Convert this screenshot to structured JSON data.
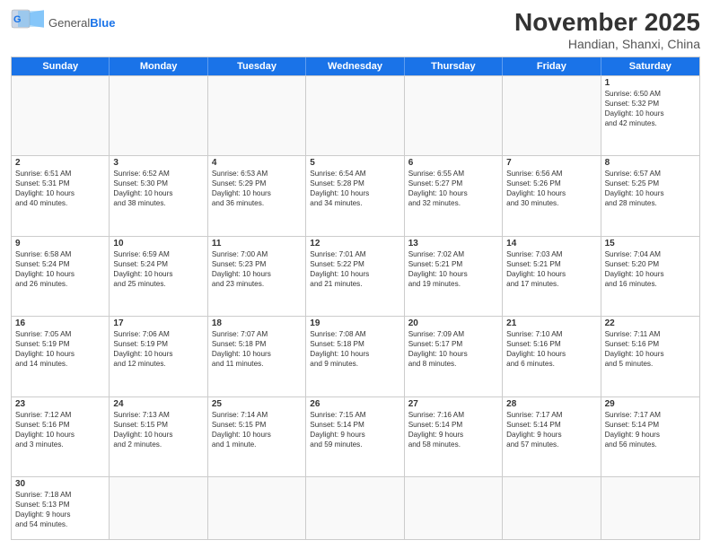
{
  "header": {
    "logo_line1": "General",
    "logo_line2": "Blue",
    "month_title": "November 2025",
    "subtitle": "Handian, Shanxi, China"
  },
  "day_headers": [
    "Sunday",
    "Monday",
    "Tuesday",
    "Wednesday",
    "Thursday",
    "Friday",
    "Saturday"
  ],
  "weeks": [
    [
      {
        "day": "",
        "info": ""
      },
      {
        "day": "",
        "info": ""
      },
      {
        "day": "",
        "info": ""
      },
      {
        "day": "",
        "info": ""
      },
      {
        "day": "",
        "info": ""
      },
      {
        "day": "",
        "info": ""
      },
      {
        "day": "1",
        "info": "Sunrise: 6:50 AM\nSunset: 5:32 PM\nDaylight: 10 hours\nand 42 minutes."
      }
    ],
    [
      {
        "day": "2",
        "info": "Sunrise: 6:51 AM\nSunset: 5:31 PM\nDaylight: 10 hours\nand 40 minutes."
      },
      {
        "day": "3",
        "info": "Sunrise: 6:52 AM\nSunset: 5:30 PM\nDaylight: 10 hours\nand 38 minutes."
      },
      {
        "day": "4",
        "info": "Sunrise: 6:53 AM\nSunset: 5:29 PM\nDaylight: 10 hours\nand 36 minutes."
      },
      {
        "day": "5",
        "info": "Sunrise: 6:54 AM\nSunset: 5:28 PM\nDaylight: 10 hours\nand 34 minutes."
      },
      {
        "day": "6",
        "info": "Sunrise: 6:55 AM\nSunset: 5:27 PM\nDaylight: 10 hours\nand 32 minutes."
      },
      {
        "day": "7",
        "info": "Sunrise: 6:56 AM\nSunset: 5:26 PM\nDaylight: 10 hours\nand 30 minutes."
      },
      {
        "day": "8",
        "info": "Sunrise: 6:57 AM\nSunset: 5:25 PM\nDaylight: 10 hours\nand 28 minutes."
      }
    ],
    [
      {
        "day": "9",
        "info": "Sunrise: 6:58 AM\nSunset: 5:24 PM\nDaylight: 10 hours\nand 26 minutes."
      },
      {
        "day": "10",
        "info": "Sunrise: 6:59 AM\nSunset: 5:24 PM\nDaylight: 10 hours\nand 25 minutes."
      },
      {
        "day": "11",
        "info": "Sunrise: 7:00 AM\nSunset: 5:23 PM\nDaylight: 10 hours\nand 23 minutes."
      },
      {
        "day": "12",
        "info": "Sunrise: 7:01 AM\nSunset: 5:22 PM\nDaylight: 10 hours\nand 21 minutes."
      },
      {
        "day": "13",
        "info": "Sunrise: 7:02 AM\nSunset: 5:21 PM\nDaylight: 10 hours\nand 19 minutes."
      },
      {
        "day": "14",
        "info": "Sunrise: 7:03 AM\nSunset: 5:21 PM\nDaylight: 10 hours\nand 17 minutes."
      },
      {
        "day": "15",
        "info": "Sunrise: 7:04 AM\nSunset: 5:20 PM\nDaylight: 10 hours\nand 16 minutes."
      }
    ],
    [
      {
        "day": "16",
        "info": "Sunrise: 7:05 AM\nSunset: 5:19 PM\nDaylight: 10 hours\nand 14 minutes."
      },
      {
        "day": "17",
        "info": "Sunrise: 7:06 AM\nSunset: 5:19 PM\nDaylight: 10 hours\nand 12 minutes."
      },
      {
        "day": "18",
        "info": "Sunrise: 7:07 AM\nSunset: 5:18 PM\nDaylight: 10 hours\nand 11 minutes."
      },
      {
        "day": "19",
        "info": "Sunrise: 7:08 AM\nSunset: 5:18 PM\nDaylight: 10 hours\nand 9 minutes."
      },
      {
        "day": "20",
        "info": "Sunrise: 7:09 AM\nSunset: 5:17 PM\nDaylight: 10 hours\nand 8 minutes."
      },
      {
        "day": "21",
        "info": "Sunrise: 7:10 AM\nSunset: 5:16 PM\nDaylight: 10 hours\nand 6 minutes."
      },
      {
        "day": "22",
        "info": "Sunrise: 7:11 AM\nSunset: 5:16 PM\nDaylight: 10 hours\nand 5 minutes."
      }
    ],
    [
      {
        "day": "23",
        "info": "Sunrise: 7:12 AM\nSunset: 5:16 PM\nDaylight: 10 hours\nand 3 minutes."
      },
      {
        "day": "24",
        "info": "Sunrise: 7:13 AM\nSunset: 5:15 PM\nDaylight: 10 hours\nand 2 minutes."
      },
      {
        "day": "25",
        "info": "Sunrise: 7:14 AM\nSunset: 5:15 PM\nDaylight: 10 hours\nand 1 minute."
      },
      {
        "day": "26",
        "info": "Sunrise: 7:15 AM\nSunset: 5:14 PM\nDaylight: 9 hours\nand 59 minutes."
      },
      {
        "day": "27",
        "info": "Sunrise: 7:16 AM\nSunset: 5:14 PM\nDaylight: 9 hours\nand 58 minutes."
      },
      {
        "day": "28",
        "info": "Sunrise: 7:17 AM\nSunset: 5:14 PM\nDaylight: 9 hours\nand 57 minutes."
      },
      {
        "day": "29",
        "info": "Sunrise: 7:17 AM\nSunset: 5:14 PM\nDaylight: 9 hours\nand 56 minutes."
      }
    ],
    [
      {
        "day": "30",
        "info": "Sunrise: 7:18 AM\nSunset: 5:13 PM\nDaylight: 9 hours\nand 54 minutes."
      },
      {
        "day": "",
        "info": ""
      },
      {
        "day": "",
        "info": ""
      },
      {
        "day": "",
        "info": ""
      },
      {
        "day": "",
        "info": ""
      },
      {
        "day": "",
        "info": ""
      },
      {
        "day": "",
        "info": ""
      }
    ]
  ]
}
